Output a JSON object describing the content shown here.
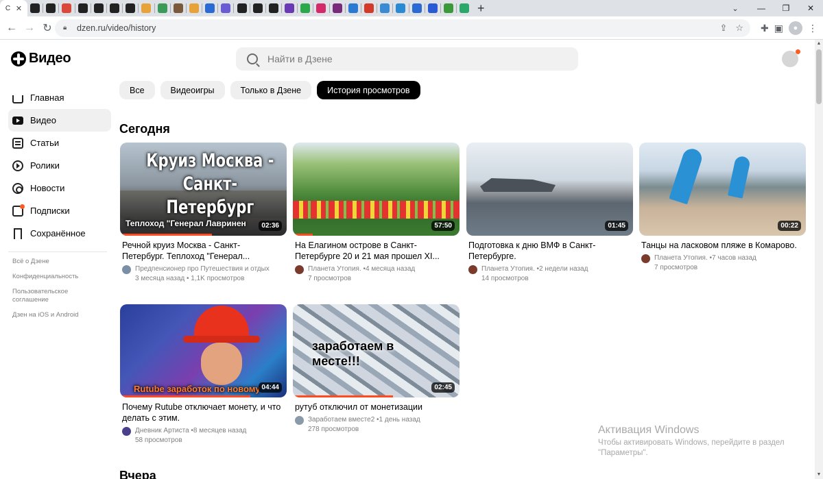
{
  "browser": {
    "active_tab_label": "С",
    "address": "dzen.ru/video/history",
    "tab_letters": [
      "Г",
      "Г",
      "Г",
      "F",
      "Г",
      "Г",
      "С",
      "Е",
      "с",
      "Е",
      "S",
      "С",
      "С",
      "С",
      "Е",
      "С",
      "С",
      "С",
      "с",
      "\\",
      "С",
      "С",
      "С",
      "Е",
      "С",
      "С",
      "С",
      "С",
      "Е",
      "Е",
      "Е",
      "Е",
      "Е",
      "Е",
      "/"
    ]
  },
  "header": {
    "logo_text": "Видео",
    "search_placeholder": "Найти в Дзене"
  },
  "sidebar": {
    "items": [
      {
        "label": "Главная",
        "icon": "home-icon"
      },
      {
        "label": "Видео",
        "icon": "video-icon"
      },
      {
        "label": "Статьи",
        "icon": "articles-icon"
      },
      {
        "label": "Ролики",
        "icon": "clips-icon"
      },
      {
        "label": "Новости",
        "icon": "news-icon"
      },
      {
        "label": "Подписки",
        "icon": "subscriptions-icon"
      },
      {
        "label": "Сохранённое",
        "icon": "bookmark-icon"
      }
    ],
    "links": [
      "Всё о Дзене",
      "Конфиденциальность",
      "Пользовательское соглашение",
      "Дзен на iOS и Android"
    ]
  },
  "chips": [
    "Все",
    "Видеоигры",
    "Только в Дзене",
    "История просмотров"
  ],
  "sections": {
    "today": "Сегодня",
    "yesterday": "Вчера"
  },
  "videos": [
    {
      "title": "Речной круиз Москва - Санкт-Петербург. Теплоход \"Генерал...",
      "channel": "Предпенсионер про Путешествия и отдых",
      "age": "3 месяца назад",
      "views": "1,1K просмотров",
      "duration": "02:36",
      "overlay": "Круиз Москва - Санкт-Петербург",
      "overlay2": "Теплоход \"Генерал Лавринен",
      "progress": 0.55
    },
    {
      "title": "На Елагином острове в Санкт-Петербурге 20 и 21 мая прошел XI...",
      "channel": "Планета Утопия.",
      "age": "4 месяца назад",
      "views": "7 просмотров",
      "duration": "57:50",
      "progress": 0.12
    },
    {
      "title": "Подготовка к дню ВМФ в Санкт-Петербурге.",
      "channel": "Планета Утопия.",
      "age": "2 недели назад",
      "views": "14 просмотров",
      "duration": "01:45",
      "progress": 0.0
    },
    {
      "title": "Танцы на ласковом пляже в Комарово.",
      "channel": "Планета Утопия.",
      "age": "7 часов назад",
      "views": "7 просмотров",
      "duration": "00:22",
      "progress": 0.0
    },
    {
      "title": "Почему Rutube отключает монету, и что делать с этим.",
      "channel": "Дневник Артиста",
      "age": "8 месяцев назад",
      "views": "58 просмотров",
      "duration": "04:44",
      "overlay": "Rutube заработок по новому",
      "progress": 0.78
    },
    {
      "title": "рутуб отключил от монетизации",
      "channel": "Заработаем вместе2",
      "age": "1 день назад",
      "views": "278 просмотров",
      "duration": "02:45",
      "overlay": "заработаем в месте!!!",
      "progress": 0.6
    }
  ],
  "watermark": {
    "line1": "Активация Windows",
    "line2": "Чтобы активировать Windows, перейдите в раздел \"Параметры\"."
  },
  "colors": {
    "accent": "#ff4b1f",
    "chip_active": "#000000",
    "chip_bg": "#efefef"
  }
}
